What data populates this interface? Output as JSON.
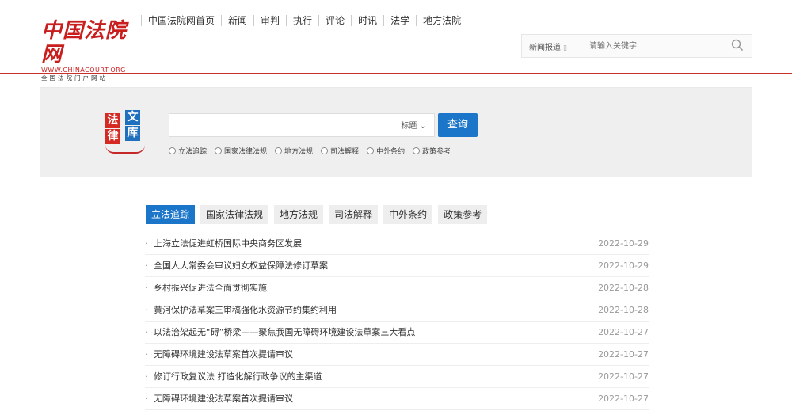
{
  "logo": {
    "mark": "中国法院网",
    "url": "WWW.CHINACOURT.ORG",
    "sub": "全国法院门户网站"
  },
  "nav": [
    "中国法院网首页",
    "新闻",
    "审判",
    "执行",
    "评论",
    "时讯",
    "法学",
    "地方法院"
  ],
  "header_search": {
    "scope": "新闻报道",
    "placeholder": "请输入关键字"
  },
  "fawen_logo": {
    "c1": "法",
    "c2": "文",
    "c3": "律",
    "c4": "库"
  },
  "search": {
    "field": "标题",
    "button": "查询",
    "value": ""
  },
  "radios": [
    "立法追踪",
    "国家法律法规",
    "地方法规",
    "司法解释",
    "中外条约",
    "政策参考"
  ],
  "tabs": [
    "立法追踪",
    "国家法律法规",
    "地方法规",
    "司法解释",
    "中外条约",
    "政策参考"
  ],
  "active_tab": "立法追踪",
  "news": [
    {
      "title": "上海立法促进虹桥国际中央商务区发展",
      "date": "2022-10-29"
    },
    {
      "title": "全国人大常委会审议妇女权益保障法修订草案",
      "date": "2022-10-29"
    },
    {
      "title": "乡村振兴促进法全面贯彻实施",
      "date": "2022-10-28"
    },
    {
      "title": "黄河保护法草案三审稿强化水资源节约集约利用",
      "date": "2022-10-28"
    },
    {
      "title": "以法治架起无“碍”桥梁——聚焦我国无障碍环境建设法草案三大看点",
      "date": "2022-10-27"
    },
    {
      "title": "无障碍环境建设法草案首次提请审议",
      "date": "2022-10-27"
    },
    {
      "title": "修订行政复议法 打造化解行政争议的主渠道",
      "date": "2022-10-27"
    },
    {
      "title": "无障碍环境建设法草案首次提请审议",
      "date": "2022-10-27"
    }
  ],
  "colors": {
    "brand_red": "#c9302c",
    "accent_blue": "#1b75c9"
  }
}
